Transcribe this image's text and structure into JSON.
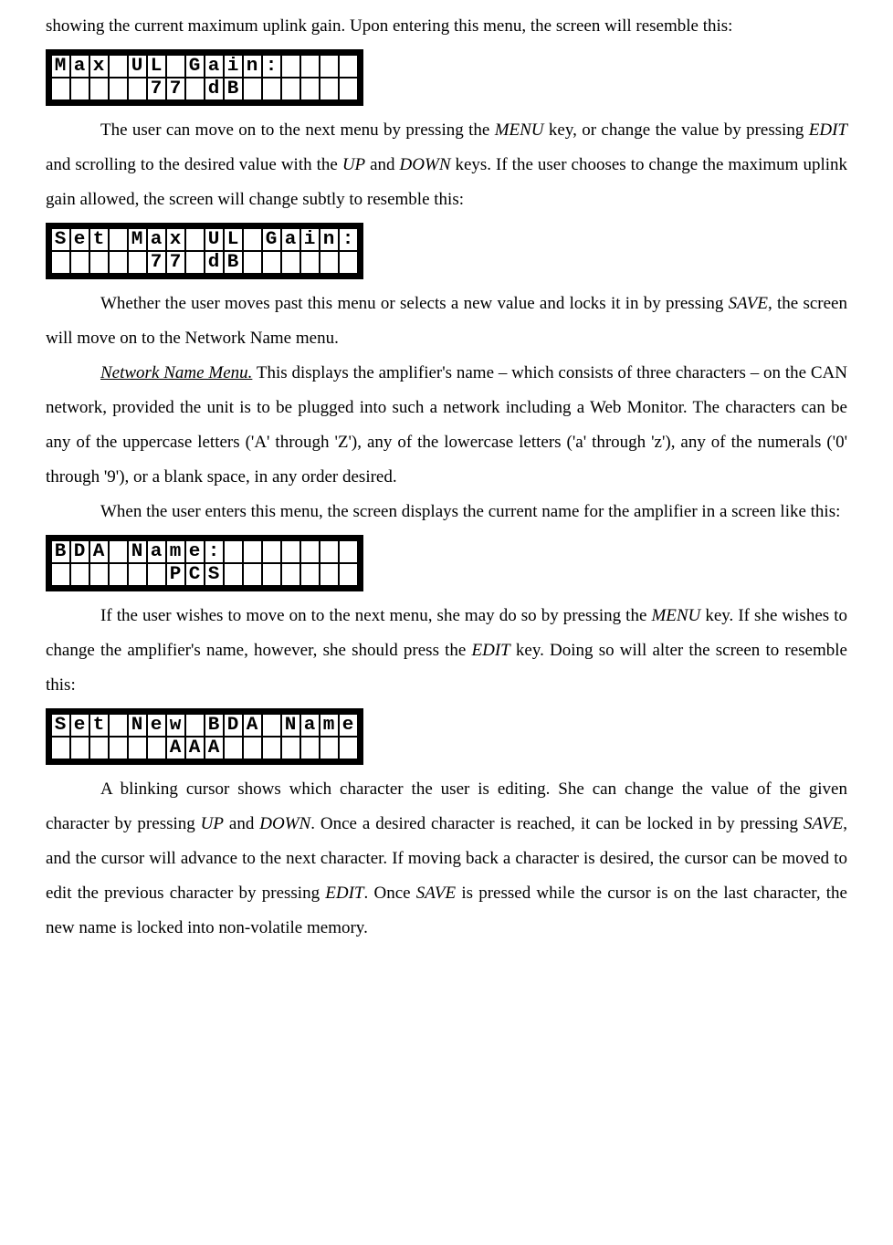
{
  "para1": "showing the current maximum uplink gain.  Upon entering this menu, the screen will resemble this:",
  "lcd1": {
    "row1": [
      "M",
      "a",
      "x",
      " ",
      "U",
      "L",
      " ",
      "G",
      "a",
      "i",
      "n",
      ":",
      " ",
      " ",
      " ",
      " "
    ],
    "row2": [
      " ",
      " ",
      " ",
      " ",
      " ",
      "7",
      "7",
      " ",
      "d",
      "B",
      " ",
      " ",
      " ",
      " ",
      " ",
      " "
    ]
  },
  "para2a": "The user can move on to the next menu by pressing the ",
  "key_menu": "MENU",
  "para2b": " key, or change the value by pressing ",
  "key_edit": "EDIT",
  "para2c": " and scrolling to the desired value with the ",
  "key_up": "UP",
  "para2d": " and ",
  "key_down": "DOWN",
  "para2e": " keys.  If the user chooses to change the maximum uplink gain allowed, the screen will change subtly to resemble this:",
  "lcd2": {
    "row1": [
      "S",
      "e",
      "t",
      " ",
      "M",
      "a",
      "x",
      " ",
      "U",
      "L",
      " ",
      "G",
      "a",
      "i",
      "n",
      ":"
    ],
    "row2": [
      " ",
      " ",
      " ",
      " ",
      " ",
      "7",
      "7",
      " ",
      "d",
      "B",
      " ",
      " ",
      " ",
      " ",
      " ",
      " "
    ]
  },
  "para3a": "Whether the user moves past this menu or selects a new value and locks it in by pressing ",
  "key_save": "SAVE",
  "para3b": ", the screen will move on to the Network Name menu.",
  "para4_title": "Network Name Menu.",
  "para4a": "   This  displays  the  amplifier's  name  –  which  consists  of  three characters  –  on  the  CAN  network,  provided  the  unit  is  to  be  plugged  into  such  a  network including a Web Monitor.  The characters can be any of the uppercase letters ('A' through 'Z'), any of the lowercase letters ('a' through 'z'), any of the numerals ('0' through '9'), or a blank space, in any order desired.",
  "para5": "When the user enters this menu, the screen displays the current name for the amplifier in a screen like this:",
  "lcd3": {
    "row1": [
      "B",
      "D",
      "A",
      " ",
      "N",
      "a",
      "m",
      "e",
      ":",
      " ",
      " ",
      " ",
      " ",
      " ",
      " ",
      " "
    ],
    "row2": [
      " ",
      " ",
      " ",
      " ",
      " ",
      " ",
      "P",
      "C",
      "S",
      " ",
      " ",
      " ",
      " ",
      " ",
      " ",
      " "
    ]
  },
  "para6a": "If the user wishes to move on to the next menu, she may do so by pressing the ",
  "para6b": " key.   If she wishes to change the amplifier's name, however, she should press the ",
  "para6c": " key.  Doing so will alter the screen to resemble this:",
  "lcd4": {
    "row1": [
      "S",
      "e",
      "t",
      " ",
      "N",
      "e",
      "w",
      " ",
      "B",
      "D",
      "A",
      " ",
      "N",
      "a",
      "m",
      "e"
    ],
    "row2": [
      " ",
      " ",
      " ",
      " ",
      " ",
      " ",
      "A",
      "A",
      "A",
      " ",
      " ",
      " ",
      " ",
      " ",
      " ",
      " "
    ]
  },
  "para7a": "A blinking cursor shows which character the user is editing.  She can change the value of the given character by pressing ",
  "para7b": " and ",
  "para7c": ".  Once a desired character is reached, it can be locked in by pressing ",
  "para7d": ", and the cursor will advance to the next character.  If moving back a character is desired, the cursor can be moved to edit the previous character by pressing ",
  "para7e": ".  Once ",
  "para7f": " is pressed while the cursor is on the last character, the new name is locked into non-volatile memory."
}
